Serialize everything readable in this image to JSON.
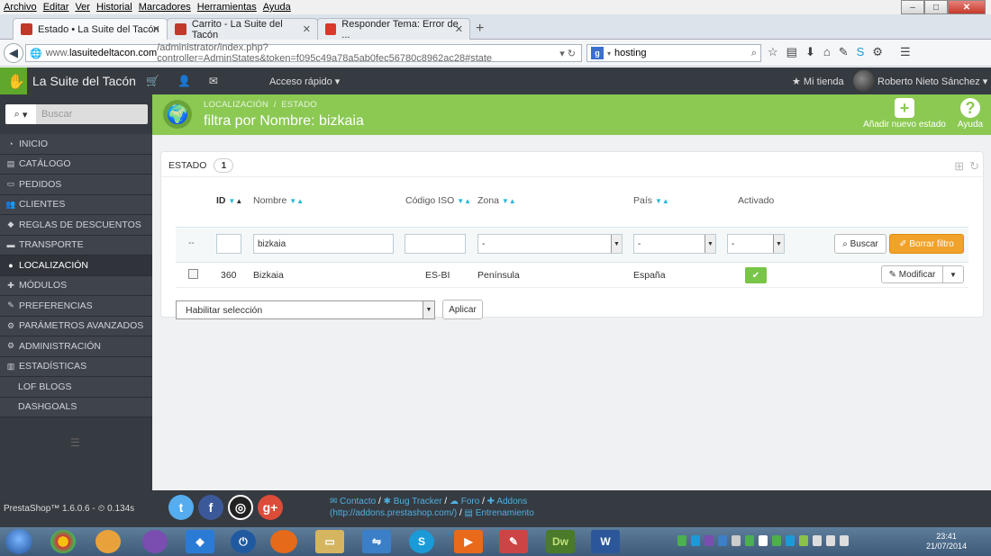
{
  "browser": {
    "menu": [
      "Archivo",
      "Editar",
      "Ver",
      "Historial",
      "Marcadores",
      "Herramientas",
      "Ayuda"
    ],
    "tabs": [
      {
        "label": "Estado • La Suite del Tacón",
        "active": true
      },
      {
        "label": "Carrito - La Suite del Tacón",
        "active": false
      },
      {
        "label": "Responder Tema: Error de ...",
        "active": false
      }
    ],
    "url_prefix": "www.",
    "url_domain": "lasuitedeltacon.com",
    "url_path": "/administrator/index.php?controller=AdminStates&token=f095c49a78a5ab0fec56780c8962ac28#state",
    "search_value": "hosting",
    "search_engine": "g"
  },
  "header": {
    "shop_name": "La Suite del Tacón",
    "quick_access": "Acceso rápido",
    "my_shop": "Mi tienda",
    "user_name": "Roberto Nieto Sánchez"
  },
  "sidebar": {
    "search_placeholder": "Buscar",
    "items": [
      {
        "label": "INICIO",
        "icon": "dashboard-icon"
      },
      {
        "label": "CATÁLOGO",
        "icon": "book-icon"
      },
      {
        "label": "PEDIDOS",
        "icon": "credit-card-icon"
      },
      {
        "label": "CLIENTES",
        "icon": "users-icon"
      },
      {
        "label": "REGLAS DE DESCUENTOS",
        "icon": "tag-icon"
      },
      {
        "label": "TRANSPORTE",
        "icon": "truck-icon"
      },
      {
        "label": "LOCALIZACIÓN",
        "icon": "globe-icon"
      },
      {
        "label": "MÓDULOS",
        "icon": "puzzle-icon"
      },
      {
        "label": "PREFERENCIAS",
        "icon": "wrench-icon"
      },
      {
        "label": "PARÁMETROS AVANZADOS",
        "icon": "cogs-icon"
      },
      {
        "label": "ADMINISTRACIÓN",
        "icon": "cog-icon"
      },
      {
        "label": "ESTADÍSTICAS",
        "icon": "bar-chart-icon"
      },
      {
        "label": "LOF BLOGS",
        "icon": ""
      },
      {
        "label": "DASHGOALS",
        "icon": ""
      }
    ]
  },
  "page": {
    "breadcrumb_1": "LOCALIZACIÓN",
    "breadcrumb_sep": "/",
    "breadcrumb_2": "ESTADO",
    "title": "filtra por Nombre: bizkaia",
    "add_new": "Añadir nuevo estado",
    "help": "Ayuda"
  },
  "panel": {
    "title": "ESTADO",
    "count": "1",
    "columns": {
      "id": "ID",
      "name": "Nombre",
      "iso": "Código ISO",
      "zone": "Zona",
      "country": "País",
      "active": "Activado"
    },
    "filter": {
      "dash": "--",
      "id_value": "",
      "name_value": "bizkaia",
      "iso_value": "",
      "zone_value": "-",
      "country_value": "-",
      "active_value": "-",
      "search_btn": "Buscar",
      "reset_btn": "Borrar filtro"
    },
    "rows": [
      {
        "id": "360",
        "name": "Bizkaia",
        "iso": "ES-BI",
        "zone": "Península",
        "country": "España",
        "edit": "Modificar"
      }
    ],
    "bulk_value": "Habilitar selección",
    "apply_btn": "Aplicar"
  },
  "footer": {
    "version": "PrestaShop™ 1.6.0.6 -",
    "timer": "0.134s",
    "links": [
      {
        "label": "Contacto"
      },
      {
        "label": "Bug Tracker"
      },
      {
        "label": "Foro"
      },
      {
        "label": "Addons"
      }
    ],
    "addons_url": "(http://addons.prestashop.com/)",
    "training": "Entrenamiento"
  },
  "taskbar": {
    "time": "23:41",
    "date": "21/07/2014"
  },
  "colors": {
    "ps_dark": "#363a41",
    "ps_green": "#8bc953",
    "ps_blue": "#25b9d7",
    "reset_orange": "#f0a22a"
  }
}
